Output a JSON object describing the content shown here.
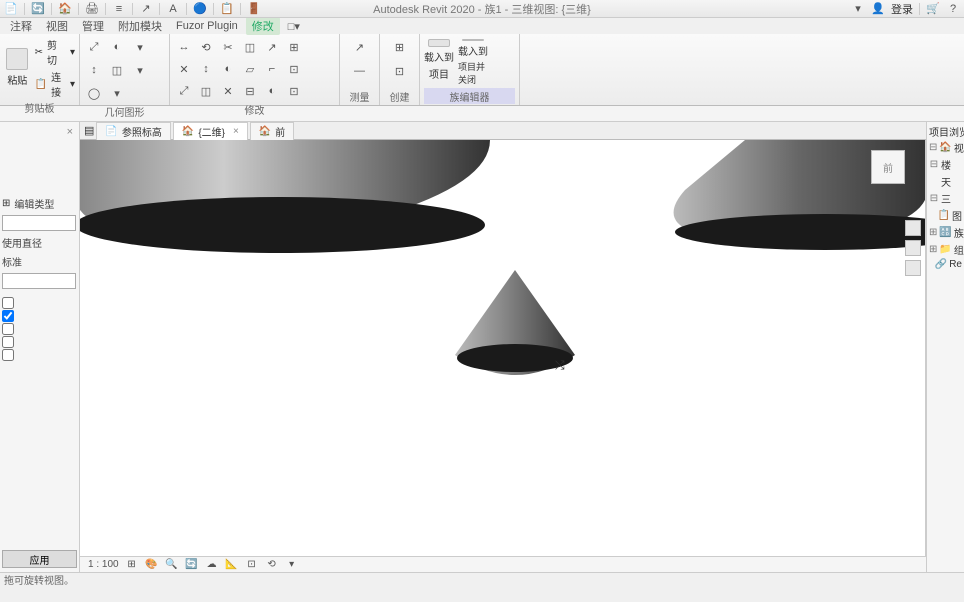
{
  "title": "Autodesk Revit 2020 - 族1 - 三维视图: {三维}",
  "qat_icons": [
    "📄",
    "·",
    "🔄",
    "·",
    "🏠",
    "·",
    "🖨",
    "·",
    "≡",
    "·",
    "↗",
    "·",
    "A",
    "·",
    "🔵",
    "·",
    "📋",
    "·",
    "🚪"
  ],
  "titlebar_right": {
    "search": "▾",
    "user_icon": "👤",
    "login": "登录",
    "cart": "🛒",
    "help": "?"
  },
  "menu": {
    "items": [
      "注释",
      "视图",
      "管理",
      "附加模块",
      "Fuzor Plugin",
      "修改"
    ],
    "active_index": 5,
    "extra": "□▾"
  },
  "ribbon": {
    "panels": [
      {
        "label": "剪贴板",
        "big": [
          {
            "label": "粘贴"
          }
        ],
        "small_rows": [
          [
            "✂",
            "剪切",
            "▾"
          ],
          [
            "📋",
            "连接",
            "▾"
          ]
        ]
      },
      {
        "label": "几何图形",
        "tools": [
          "⤢",
          "◐",
          "▾",
          "↕",
          "◫",
          "▾",
          "◯",
          "▾"
        ]
      },
      {
        "label": "修改",
        "tools": [
          "↔",
          "⟲",
          "✂",
          "◫",
          "↗",
          "⊞",
          "✕",
          "↕",
          "◐",
          "▱",
          "⌐",
          "⊡",
          "⤢",
          "◫",
          "✕",
          "⊟",
          "◐",
          "⊡"
        ]
      },
      {
        "label": "测量",
        "tools": [
          "↗",
          "—"
        ]
      },
      {
        "label": "创建",
        "tools": [
          "⊞",
          "⊡"
        ]
      },
      {
        "label": "族编辑器",
        "big": [
          {
            "label_a": "载入到",
            "label_b": "项目"
          },
          {
            "label_a": "载入到",
            "label_b": "项目并关闭"
          }
        ]
      }
    ]
  },
  "view_tabs": [
    {
      "icon": "📄",
      "label": "参照标高",
      "closable": false
    },
    {
      "icon": "🏠",
      "label": "{二维}",
      "closable": true,
      "active": true
    },
    {
      "icon": "🏠",
      "label": "前",
      "closable": false
    }
  ],
  "left_panel": {
    "title_icon": "×",
    "edit_label": "编辑类型",
    "name_label": "使用直径",
    "std_label": "标准",
    "checks": [
      false,
      true,
      false,
      false,
      false
    ],
    "apply": "应用"
  },
  "viewcube": "前",
  "scale": {
    "value": "1 : 100",
    "icons": [
      "⊞",
      "🎨",
      "🔍",
      "🔄",
      "☁",
      "📐",
      "⊡",
      "⟲",
      "▾"
    ]
  },
  "right_panel": {
    "header": "项目浏览器",
    "tree": [
      {
        "t": "⊟",
        "icon": "🏠",
        "label": "视"
      },
      {
        "t": "⊟",
        "icon": "",
        "label": "楼"
      },
      {
        "t": "",
        "icon": "",
        "label": "天"
      },
      {
        "t": "⊟",
        "icon": "",
        "label": "三"
      },
      {
        "t": "",
        "icon": "",
        "label": ""
      },
      {
        "t": "",
        "icon": "📋",
        "label": "图"
      },
      {
        "t": "⊞",
        "icon": "🔠",
        "label": "族"
      },
      {
        "t": "⊞",
        "icon": "📁",
        "label": "组"
      },
      {
        "t": "",
        "icon": "🔗",
        "label": "Re"
      }
    ]
  },
  "status": "拖可旋转视图。"
}
